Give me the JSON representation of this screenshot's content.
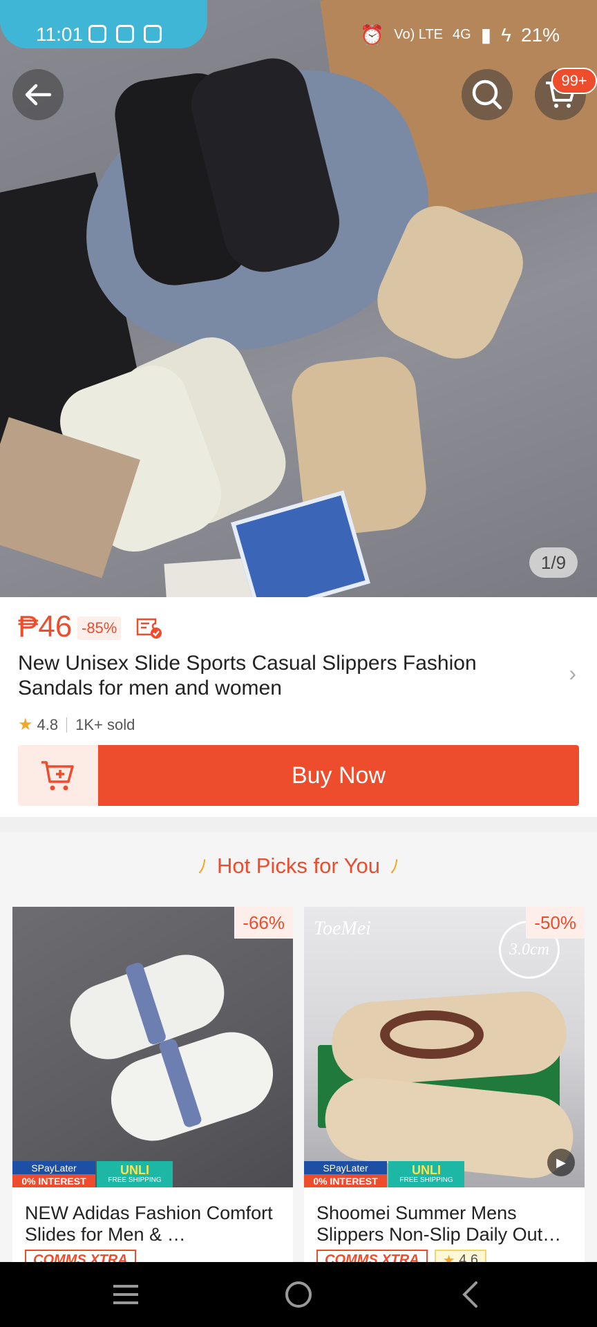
{
  "status_bar": {
    "time": "11:01",
    "network": "4G",
    "battery": "21%",
    "volte": "Vo) LTE"
  },
  "top_bar": {
    "cart_badge": "99+"
  },
  "gallery": {
    "counter": "1/9"
  },
  "product": {
    "price": "₱46",
    "discount": "-85%",
    "title": "New Unisex Slide  Sports Casual Slippers Fashion Sandals for men and women",
    "rating": "4.8",
    "sold": "1K+ sold",
    "buy_now_label": "Buy Now"
  },
  "hot_picks": {
    "title": "Hot Picks for You",
    "items": [
      {
        "discount": "-66%",
        "title": "NEW Adidas Fashion Comfort Slides for Men & …",
        "tag": "COMMS XTRA",
        "spay_line1": "SPayLater",
        "spay_line2": "0% INTEREST",
        "unli_line1": "UNLI",
        "unli_line2": "FREE SHIPPING"
      },
      {
        "discount": "-50%",
        "title": "Shoomei Summer Mens Slippers Non-Slip Daily Out…",
        "tag": "COMMS XTRA",
        "rating": "4.6",
        "brand": "ToeMei",
        "size_note": "3.0cm",
        "spay_line1": "SPayLater",
        "spay_line2": "0% INTEREST",
        "unli_line1": "UNLI",
        "unli_line2": "FREE SHIPPING"
      }
    ]
  },
  "colors": {
    "accent": "#ee4d2d",
    "star": "#f5a623"
  }
}
